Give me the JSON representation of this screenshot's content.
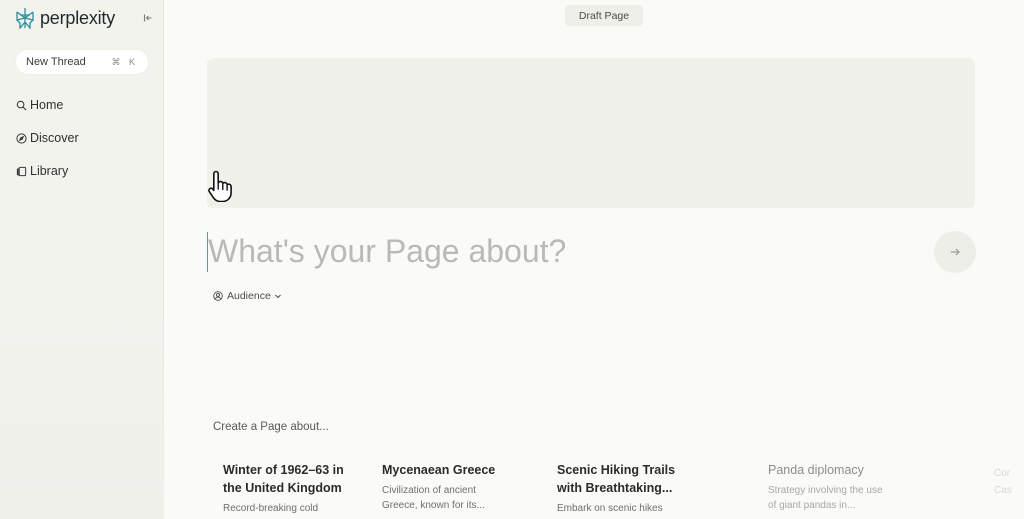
{
  "app": {
    "logo_text": "perplexity",
    "brand_color": "#2a8f9a"
  },
  "sidebar": {
    "new_thread_label": "New Thread",
    "new_thread_shortcut": "⌘ K",
    "items": [
      {
        "label": "Home",
        "icon": "search-icon"
      },
      {
        "label": "Discover",
        "icon": "compass-icon"
      },
      {
        "label": "Library",
        "icon": "library-icon"
      }
    ]
  },
  "topbar": {
    "page_status": "Draft Page"
  },
  "editor": {
    "title_placeholder": "What's your Page about?",
    "audience_label": "Audience"
  },
  "suggestions": {
    "heading": "Create a Page about...",
    "cards": [
      {
        "title": "Winter of 1962–63 in the United Kingdom",
        "desc": "Record-breaking cold"
      },
      {
        "title": "Mycenaean Greece",
        "desc": "Civilization of ancient Greece, known for its..."
      },
      {
        "title": "Scenic Hiking Trails with Breathtaking...",
        "desc": "Embark on scenic hikes"
      },
      {
        "title": "Panda diplomacy",
        "desc": "Strategy involving the use of giant pandas in..."
      }
    ],
    "edge_ghost_text": "Cor Cas"
  }
}
